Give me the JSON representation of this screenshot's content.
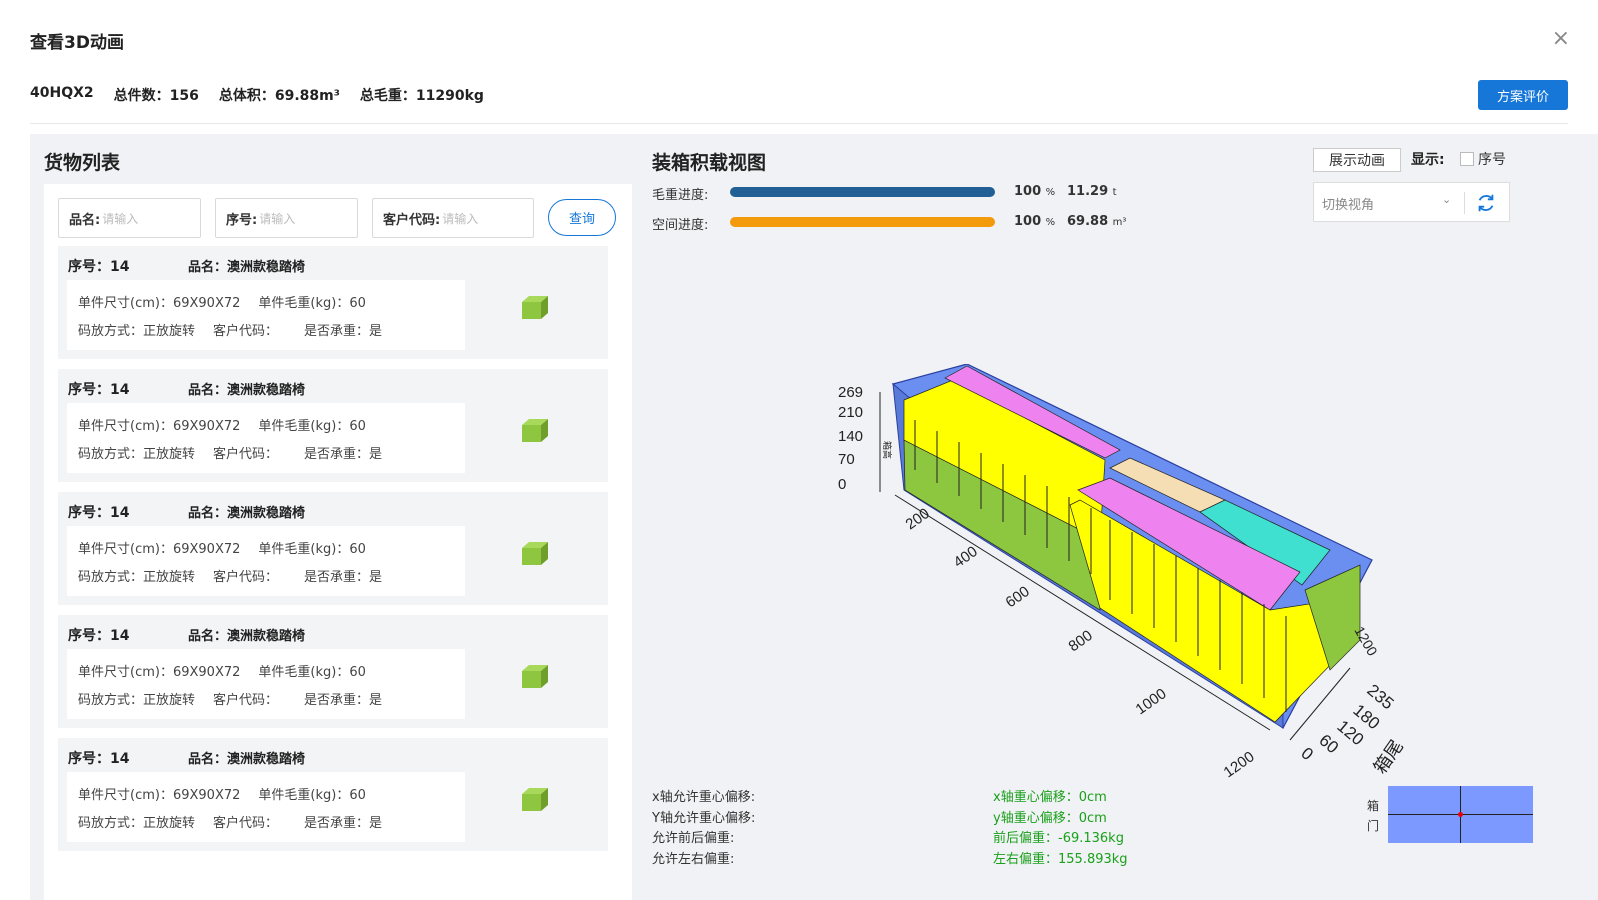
{
  "modal": {
    "title": "查看3D动画"
  },
  "summary": {
    "container": "40HQX2",
    "total_count": "总件数：156",
    "total_volume": "总体积：69.88m³",
    "total_weight": "总毛重：11290kg",
    "eval_button": "方案评价"
  },
  "cargo": {
    "title": "货物列表",
    "filters": [
      {
        "label": "品名:",
        "placeholder": "请输入"
      },
      {
        "label": "序号:",
        "placeholder": "请输入"
      },
      {
        "label": "客户代码:",
        "placeholder": "请输入"
      }
    ],
    "query_button": "查询",
    "items": [
      {
        "seq": "序号：14",
        "name": "品名：澳洲款稳踏椅",
        "size": "单件尺寸(cm)：69X90X72",
        "weight": "单件毛重(kg)：60",
        "mode": "码放方式：正放旋转",
        "customer": "客户代码：",
        "bearing": "是否承重：是"
      },
      {
        "seq": "序号：14",
        "name": "品名：澳洲款稳踏椅",
        "size": "单件尺寸(cm)：69X90X72",
        "weight": "单件毛重(kg)：60",
        "mode": "码放方式：正放旋转",
        "customer": "客户代码：",
        "bearing": "是否承重：是"
      },
      {
        "seq": "序号：14",
        "name": "品名：澳洲款稳踏椅",
        "size": "单件尺寸(cm)：69X90X72",
        "weight": "单件毛重(kg)：60",
        "mode": "码放方式：正放旋转",
        "customer": "客户代码：",
        "bearing": "是否承重：是"
      },
      {
        "seq": "序号：14",
        "name": "品名：澳洲款稳踏椅",
        "size": "单件尺寸(cm)：69X90X72",
        "weight": "单件毛重(kg)：60",
        "mode": "码放方式：正放旋转",
        "customer": "客户代码：",
        "bearing": "是否承重：是"
      },
      {
        "seq": "序号：14",
        "name": "品名：澳洲款稳踏椅",
        "size": "单件尺寸(cm)：69X90X72",
        "weight": "单件毛重(kg)：60",
        "mode": "码放方式：正放旋转",
        "customer": "客户代码：",
        "bearing": "是否承重：是"
      }
    ]
  },
  "loading": {
    "title": "装箱积载视图",
    "weight_progress": {
      "label": "毛重进度:",
      "percent": "100",
      "percent_unit": "%",
      "value": "11.29",
      "unit": "t",
      "fraction": 1.0,
      "color": "#215f95"
    },
    "space_progress": {
      "label": "空间进度:",
      "percent": "100",
      "percent_unit": "%",
      "value": "69.88",
      "unit": "m³",
      "fraction": 1.0,
      "color": "#f39a0d"
    },
    "animate_button": "展示动画",
    "show_label": "显示:",
    "seq_checkbox_label": "序号",
    "view_placeholder": "切换视角",
    "axis": {
      "height_ticks": [
        "269",
        "210",
        "140",
        "70",
        "0"
      ],
      "height_label": "箱高",
      "length_ticks": [
        "200",
        "400",
        "600",
        "800",
        "1000",
        "1200"
      ],
      "width_ticks": [
        "0",
        "60",
        "120",
        "180",
        "235"
      ],
      "corner_tick": "1200",
      "width_label": "箱尾"
    },
    "stats_left": [
      "x轴允许重心偏移:",
      "Y轴允许重心偏移:",
      "允许前后偏重:",
      "允许左右偏重:"
    ],
    "stats_right": [
      "x轴重心偏移：0cm",
      "y轴重心偏移：0cm",
      "前后偏重：-69.136kg",
      "左右偏重：155.893kg"
    ],
    "door_label": "箱门"
  },
  "colors": {
    "accent": "#1677d9",
    "cube_green": "#8ec63f",
    "box_yellow": "#ffff00",
    "box_green": "#8dc63f",
    "box_pink": "#ee82ee",
    "box_beige": "#f5deb3",
    "box_cyan": "#40e0d0",
    "container_blue": "#6a8ff0"
  }
}
